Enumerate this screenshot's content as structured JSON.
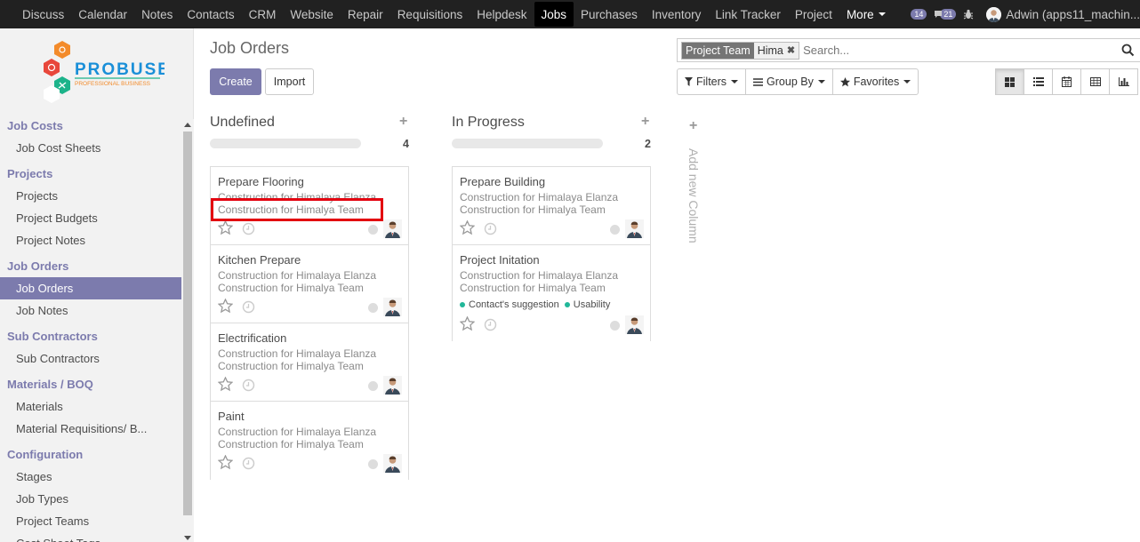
{
  "topnav": {
    "items": [
      "Discuss",
      "Calendar",
      "Notes",
      "Contacts",
      "CRM",
      "Website",
      "Repair",
      "Requisitions",
      "Helpdesk",
      "Jobs",
      "Purchases",
      "Inventory",
      "Link Tracker",
      "Project"
    ],
    "active": "Jobs",
    "more": "More",
    "activity_count": "14",
    "message_count": "21",
    "user": "Adwin (apps11_machin..."
  },
  "logo": {
    "name": "PROBUSE",
    "tagline": "PROFESSIONAL BUSINESS"
  },
  "sidebar": {
    "sections": [
      {
        "title": "Job Costs",
        "items": [
          "Job Cost Sheets"
        ]
      },
      {
        "title": "Projects",
        "items": [
          "Projects",
          "Project Budgets",
          "Project Notes"
        ]
      },
      {
        "title": "Job Orders",
        "items": [
          "Job Orders",
          "Job Notes"
        ]
      },
      {
        "title": "Sub Contractors",
        "items": [
          "Sub Contractors"
        ]
      },
      {
        "title": "Materials / BOQ",
        "items": [
          "Materials",
          "Material Requisitions/ B..."
        ]
      },
      {
        "title": "Configuration",
        "items": [
          "Stages",
          "Job Types",
          "Project Teams",
          "Cost Sheet Tags"
        ]
      }
    ],
    "active_item": "Job Orders"
  },
  "page": {
    "title": "Job Orders",
    "create": "Create",
    "import": "Import"
  },
  "search": {
    "facet_label": "Project Team",
    "facet_value": "Hima",
    "placeholder": "Search..."
  },
  "filters": {
    "filters": "Filters",
    "group_by": "Group By",
    "favorites": "Favorites"
  },
  "kanban": {
    "columns": [
      {
        "title": "Undefined",
        "count": "4",
        "cards": [
          {
            "name": "Prepare Flooring",
            "project": "Construction for Himalaya Elanza",
            "team": "Construction for Himalya Team"
          },
          {
            "name": "Kitchen Prepare",
            "project": "Construction for Himalaya Elanza",
            "team": "Construction for Himalya Team"
          },
          {
            "name": "Electrification",
            "project": "Construction for Himalaya Elanza",
            "team": "Construction for Himalya Team"
          },
          {
            "name": "Paint",
            "project": "Construction for Himalaya Elanza",
            "team": "Construction for Himalya Team"
          }
        ]
      },
      {
        "title": "In Progress",
        "count": "2",
        "cards": [
          {
            "name": "Prepare Building",
            "project": "Construction for Himalaya Elanza",
            "team": "Construction for Himalya Team"
          },
          {
            "name": "Project Initation",
            "project": "Construction for Himalaya Elanza",
            "team": "Construction for Himalya Team",
            "tags": [
              "Contact's suggestion",
              "Usability"
            ]
          }
        ]
      }
    ],
    "add_column": "Add new Column"
  },
  "colors": {
    "brand": "#7c7bad",
    "navbar": "#212121",
    "highlight": "#e3000f",
    "tag_dot": "#21b799"
  }
}
